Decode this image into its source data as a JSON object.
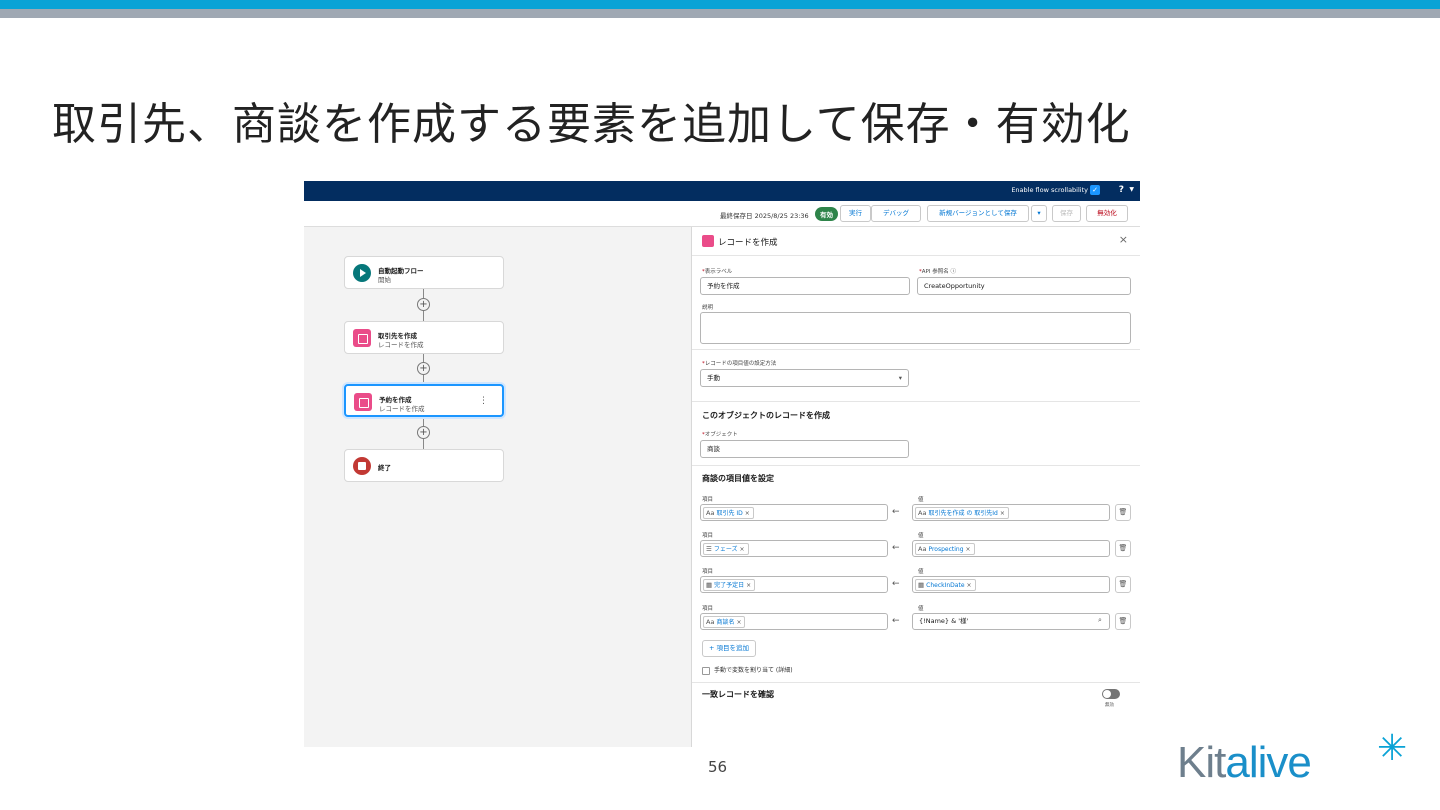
{
  "slide": {
    "title": "取引先、商談を作成する要素を追加して保存・有効化",
    "page_number": "56",
    "logo": "Kitalive"
  },
  "header": {
    "scroll_label": "Enable flow scrollability",
    "help": "?"
  },
  "toolbar": {
    "saved": "最終保存日 2025/8/25 23:36",
    "status_badge": "有効",
    "run": "実行",
    "debug": "デバッグ",
    "save_new_version": "新規バージョンとして保存",
    "save": "保存",
    "deactivate": "無効化"
  },
  "canvas": {
    "nodes": [
      {
        "title": "自動起動フロー",
        "subtitle": "開始"
      },
      {
        "title": "取引先を作成",
        "subtitle": "レコードを作成"
      },
      {
        "title": "予約を作成",
        "subtitle": "レコードを作成"
      },
      {
        "title": "終了",
        "subtitle": ""
      }
    ]
  },
  "panel": {
    "title": "レコードを作成",
    "label_label": "表示ラベル",
    "label_value": "予約を作成",
    "api_label": "API 参照名",
    "api_value": "CreateOpportunity",
    "description_label": "説明",
    "method_label": "レコードの項目値の設定方法",
    "method_value": "手動",
    "object_section": "このオブジェクトのレコードを作成",
    "object_label": "オブジェクト",
    "object_value": "商談",
    "fields_section": "商談の項目値を設定",
    "field_header": "項目",
    "value_header": "値",
    "rows": [
      {
        "field": "取引先 ID",
        "value": "取引先を作成 の 取引先Id"
      },
      {
        "field": "フェーズ",
        "value": "Prospecting"
      },
      {
        "field": "完了予定日",
        "value": "CheckInDate"
      },
      {
        "field": "商談名",
        "value": "{!Name} & '様'"
      }
    ],
    "add_field": "項目を追加",
    "manual_assign": "手動で変数を割り当て (詳細)",
    "match_section": "一致レコードを確認",
    "toggle_label": "無効"
  },
  "colors": {
    "header_navy": "#032d60",
    "accent_blue": "#0176d3",
    "active_green": "#2e844a",
    "create_pink": "#ea4c89",
    "slide_bar": "#0aa3d6"
  }
}
